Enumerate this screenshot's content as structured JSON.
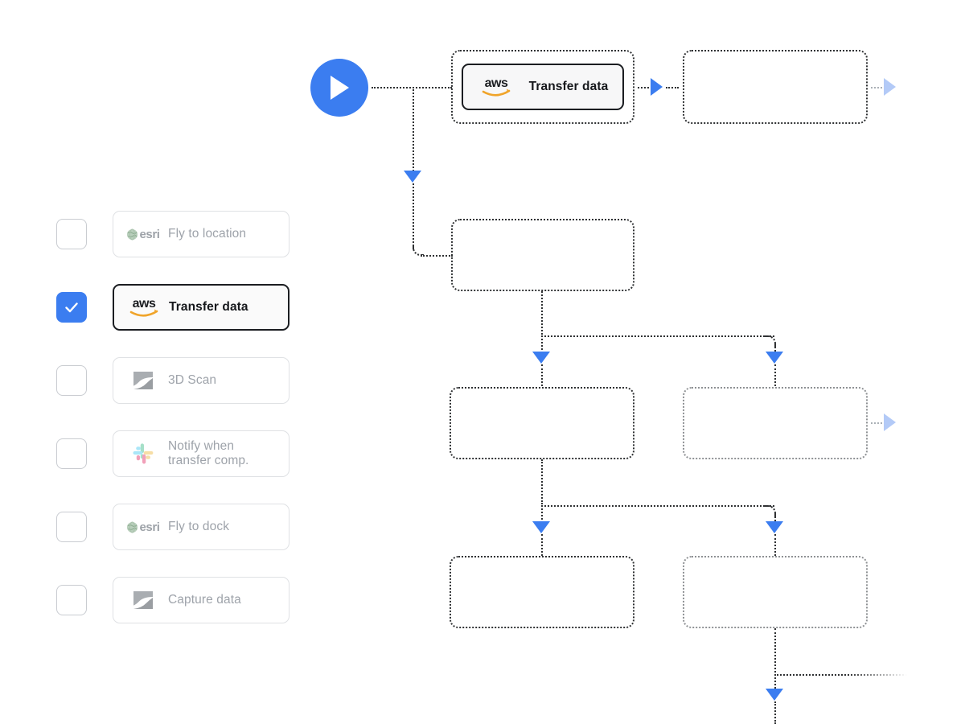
{
  "theme": {
    "accent_blue": "#3b7df0",
    "pale_blue": "#b3caf7",
    "node_border": "#2f3133",
    "muted_text": "#9ea3aa",
    "active_text": "#16181c"
  },
  "action_list": {
    "name": "workflow-action-list",
    "items": [
      {
        "label": "Fly to location",
        "label_line2": "",
        "icon": "esri-globe-icon",
        "brand": "esri",
        "checked": false,
        "active": false
      },
      {
        "label": "Transfer data",
        "label_line2": "",
        "icon": "aws-logo-icon",
        "brand": "aws",
        "checked": true,
        "active": true
      },
      {
        "label": "3D Scan",
        "label_line2": "",
        "icon": "scanner-logo-icon",
        "brand": "scan",
        "checked": false,
        "active": false
      },
      {
        "label": "Notify when",
        "label_line2": "transfer comp.",
        "icon": "slack-logo-icon",
        "brand": "slack",
        "checked": false,
        "active": false
      },
      {
        "label": "Fly to dock",
        "label_line2": "",
        "icon": "esri-globe-icon",
        "brand": "esri",
        "checked": false,
        "active": false
      },
      {
        "label": "Capture data",
        "label_line2": "",
        "icon": "scanner-logo-icon",
        "brand": "scan",
        "checked": false,
        "active": false
      }
    ]
  },
  "flow": {
    "start": {
      "name": "play-start-button",
      "icon": "play-icon"
    },
    "nodes": [
      {
        "id": "node-1",
        "label": "Transfer data",
        "icon": "aws-logo-icon",
        "filled": true
      },
      {
        "id": "node-2",
        "label": "",
        "icon": "",
        "filled": false
      },
      {
        "id": "node-3",
        "label": "",
        "icon": "",
        "filled": false
      },
      {
        "id": "node-4",
        "label": "",
        "icon": "",
        "filled": false
      },
      {
        "id": "node-5",
        "label": "",
        "icon": "",
        "filled": false
      },
      {
        "id": "node-6",
        "label": "",
        "icon": "",
        "filled": false
      },
      {
        "id": "node-7",
        "label": "",
        "icon": "",
        "filled": false
      }
    ]
  }
}
